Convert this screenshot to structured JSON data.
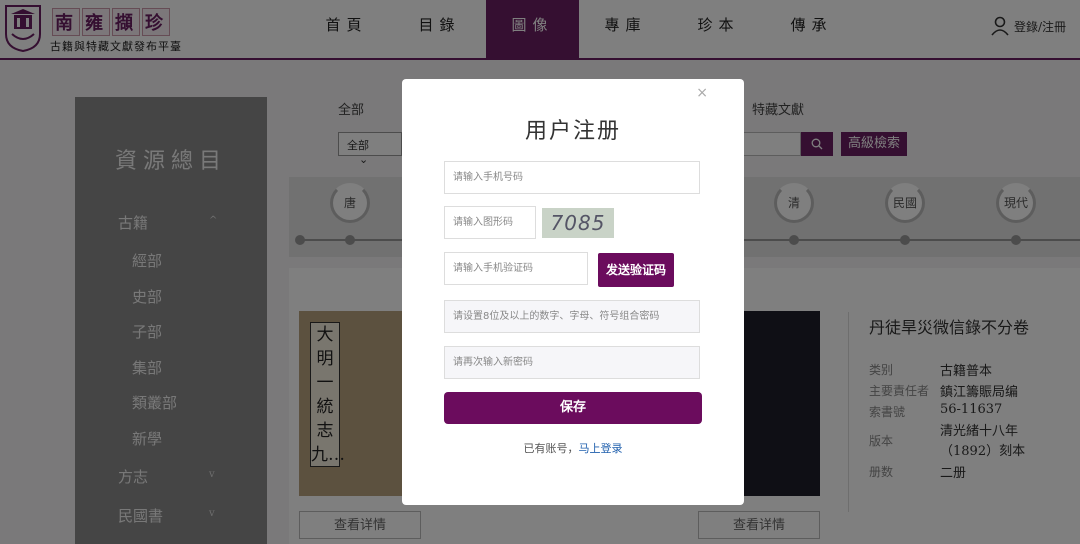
{
  "header": {
    "logo_title_chars": [
      "南",
      "雍",
      "擷",
      "珍"
    ],
    "logo_sub": "古籍與特藏文獻發布平臺",
    "nav": [
      "首頁",
      "目錄",
      "圖像",
      "專庫",
      "珍本",
      "傳承"
    ],
    "active_nav": 2,
    "login_label": "登錄/注冊"
  },
  "sidebar": {
    "title": "資源總目",
    "items": [
      {
        "label": "古籍",
        "arrow": "^"
      },
      {
        "label": "經部"
      },
      {
        "label": "史部"
      },
      {
        "label": "子部"
      },
      {
        "label": "集部"
      },
      {
        "label": "類叢部"
      },
      {
        "label": "新學"
      },
      {
        "label": "方志",
        "arrow": "v"
      },
      {
        "label": "民國書",
        "arrow": "v"
      }
    ]
  },
  "filters": {
    "all_label": "全部",
    "select_value": "全部",
    "special_label": "特藏文獻",
    "advanced_search": "高級檢索"
  },
  "timeline": [
    "唐",
    "清",
    "民國",
    "現代"
  ],
  "book": {
    "spine_text": "大明一統志九…",
    "title": "丹徒旱災微信錄不分卷",
    "rows": [
      {
        "label": "类别",
        "value": "古籍普本"
      },
      {
        "label": "主要責任者",
        "value": "鎮江籌賑局编"
      },
      {
        "label": "索書號",
        "value": "56-11637"
      },
      {
        "label": "版本",
        "value": "清光緒十八年（1892）刻本"
      },
      {
        "label": "册数",
        "value": "二册"
      }
    ],
    "detail_button": "查看详情"
  },
  "modal": {
    "title": "用户注册",
    "close_icon": "×",
    "phone_placeholder": "请输入手机号码",
    "captcha_placeholder": "请输入图形码",
    "captcha_text": "7085",
    "sms_placeholder": "请输入手机验证码",
    "send_code_label": "发送验证码",
    "password_placeholder": "请设置8位及以上的数字、字母、符号组合密码",
    "confirm_placeholder": "请再次输入新密码",
    "save_label": "保存",
    "has_account_text": "已有账号，",
    "login_link": "马上登录"
  },
  "colors": {
    "brand": "#6b1f63",
    "button": "#6b0c5d"
  }
}
